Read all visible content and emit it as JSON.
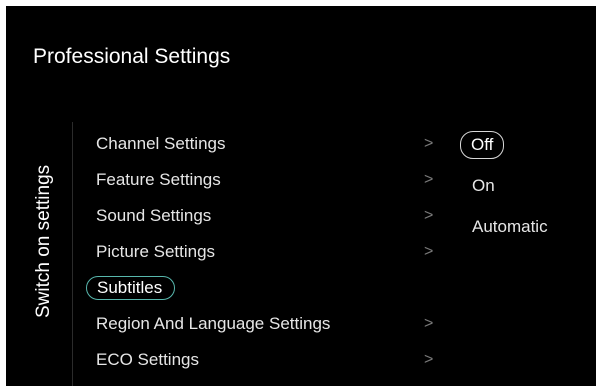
{
  "header": {
    "title": "Professional Settings"
  },
  "side_label": "Switch on settings",
  "menu": {
    "items": [
      {
        "label": "Channel Settings",
        "chevron": ">"
      },
      {
        "label": "Feature Settings",
        "chevron": ">"
      },
      {
        "label": "Sound Settings",
        "chevron": ">"
      },
      {
        "label": "Picture Settings",
        "chevron": ">"
      },
      {
        "label": "Subtitles",
        "chevron": ""
      },
      {
        "label": "Region And Language Settings",
        "chevron": ">"
      },
      {
        "label": "ECO Settings",
        "chevron": ">"
      }
    ],
    "selected_index": 4
  },
  "options": {
    "items": [
      {
        "label": "Off"
      },
      {
        "label": "On"
      },
      {
        "label": "Automatic"
      }
    ],
    "selected_index": 0
  },
  "colors": {
    "background": "#000000",
    "text": "#e6e6e6",
    "focus_outline": "#58b7ad",
    "selected_option_outline": "#d8d8d8",
    "chevron": "#7a7a7a"
  }
}
